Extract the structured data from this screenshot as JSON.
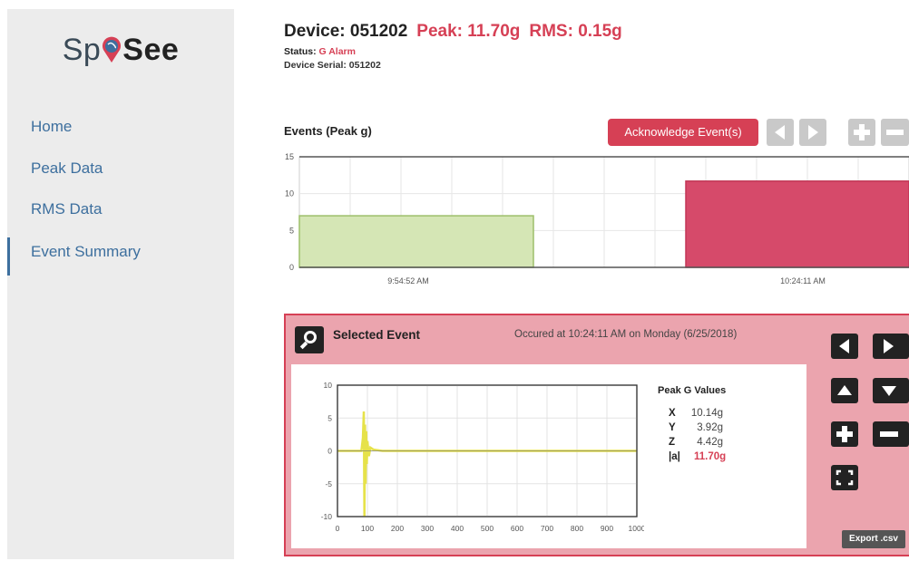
{
  "logo": {
    "pre": "Sp",
    "post": "See"
  },
  "nav": [
    {
      "label": "Home",
      "active": false
    },
    {
      "label": "Peak Data",
      "active": false
    },
    {
      "label": "RMS Data",
      "active": false
    },
    {
      "label": "Event Summary",
      "active": true
    }
  ],
  "header": {
    "device": "Device: 051202",
    "peak": "Peak: 11.70g",
    "rms": "RMS: 0.15g",
    "status_label": "Status:",
    "status_value": "G Alarm",
    "serial": "Device Serial: 051202"
  },
  "events": {
    "title": "Events (Peak g)",
    "ack_label": "Acknowledge Event(s)"
  },
  "selected": {
    "title": "Selected Event",
    "when": "Occured at 10:24:11 AM on Monday (6/25/2018)",
    "export_label": "Export .csv",
    "peak_title": "Peak G Values",
    "values": [
      {
        "axis": "X",
        "value": "10.14g"
      },
      {
        "axis": "Y",
        "value": "3.92g"
      },
      {
        "axis": "Z",
        "value": "4.42g"
      },
      {
        "axis": "|a|",
        "value": "11.70g"
      }
    ]
  },
  "colors": {
    "accent": "#d64055",
    "nav": "#3d6f9e",
    "green_bar": "#d5e6b5",
    "red_bar": "#d64a6a",
    "trace": "#e6e24a"
  },
  "chart_data": [
    {
      "type": "bar",
      "title": "Events (Peak g)",
      "categories": [
        "9:54:52 AM",
        "10:24:11 AM"
      ],
      "values": [
        7.0,
        11.7
      ],
      "ylim": [
        0,
        15
      ],
      "yticks": [
        "0",
        "5",
        "10",
        "15"
      ],
      "grid": true
    },
    {
      "type": "line",
      "xlim": [
        0,
        1000
      ],
      "ylim": [
        -10,
        10
      ],
      "xticks": [
        "0",
        "100",
        "200",
        "300",
        "400",
        "500",
        "600",
        "700",
        "800",
        "900",
        "1000"
      ],
      "yticks": [
        "10",
        "5",
        "0",
        "-5",
        "-10"
      ],
      "grid": true,
      "series": [
        {
          "x": [
            0,
            80,
            85,
            88,
            90,
            92,
            94,
            96,
            98,
            100,
            105,
            110,
            120,
            150,
            200,
            1000
          ],
          "y": [
            0,
            0,
            2,
            6,
            -10,
            4,
            -5,
            3,
            -2,
            1.5,
            -0.8,
            0.5,
            0.2,
            0,
            0,
            0
          ]
        }
      ]
    }
  ]
}
